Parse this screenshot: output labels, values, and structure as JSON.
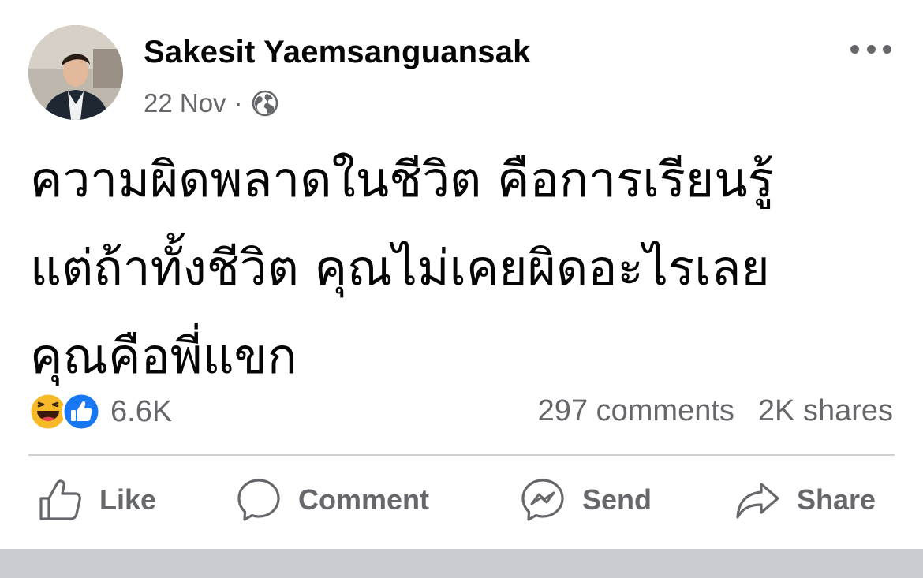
{
  "post": {
    "author": {
      "name": "Sakesit Yaemsanguansak"
    },
    "date": "22 Nov",
    "meta_separator": "·",
    "privacy_icon": "globe-icon",
    "more_icon": "more-horizontal-icon",
    "text_lines": [
      "ความผิดพลาดในชีวิต คือการเรียนรู้",
      "แต่ถ้าทั้งชีวิต คุณไม่เคยผิดอะไรเลย",
      "คุณคือพี่แขก"
    ],
    "reactions": {
      "icons": [
        "haha-reaction-icon",
        "like-reaction-icon"
      ],
      "count": "6.6K"
    },
    "comments": "297 comments",
    "shares": "2K shares"
  },
  "actions": {
    "like": {
      "label": "Like",
      "icon": "thumbs-up-icon"
    },
    "comment": {
      "label": "Comment",
      "icon": "speech-bubble-icon"
    },
    "send": {
      "label": "Send",
      "icon": "messenger-icon"
    },
    "share": {
      "label": "Share",
      "icon": "share-arrow-icon"
    }
  },
  "colors": {
    "text_primary": "#050505",
    "text_secondary": "#65676b",
    "like_blue": "#1877f2",
    "haha_yellow": "#f7b928",
    "divider": "#ced0d4",
    "band": "#c9ccd1"
  }
}
